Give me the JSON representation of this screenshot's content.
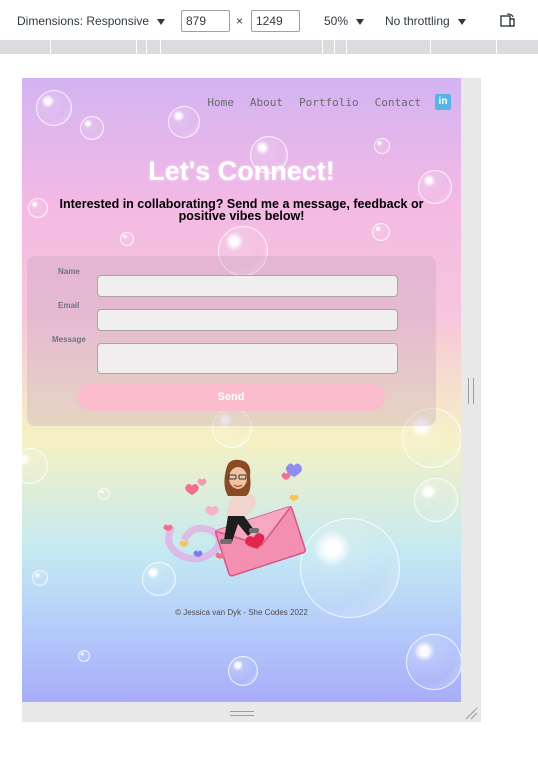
{
  "devtools": {
    "dimensions_label": "Dimensions: Responsive",
    "width_value": "879",
    "times_symbol": "×",
    "height_value": "1249",
    "zoom": "50%",
    "throttling": "No throttling",
    "rotate_icon": "rotate-icon"
  },
  "nav": {
    "items": [
      "Home",
      "About",
      "Portfolio",
      "Contact"
    ],
    "social_icon": "linkedin-icon",
    "social_text": "in"
  },
  "hero": {
    "title": "Let's Connect!",
    "subtitle": "Interested in collaborating? Send me a message, feedback or positive vibes below!"
  },
  "form": {
    "name_label": "Name",
    "email_label": "Email",
    "message_label": "Message",
    "send_label": "Send"
  },
  "footer": {
    "text": "© Jessica van Dyk - She Codes 2022"
  },
  "colors": {
    "accent_pink": "#fbbccd",
    "linkedin_blue": "#57b5e6"
  }
}
